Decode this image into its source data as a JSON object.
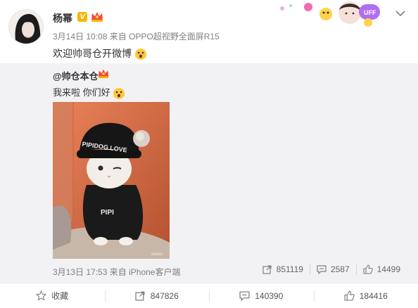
{
  "post": {
    "author": "杨幂",
    "verified_badge": "V",
    "time": "3月14日 10:08",
    "source_prefix": "来自",
    "source": "OPPO超视野全面屏R15",
    "text": "欢迎帅哥仓开微博"
  },
  "repost": {
    "author": "@帅仓本仓",
    "text": "我来啦 你们好",
    "photo_caption": "PIPIDOG LOVE",
    "shirt_text": "PIPI",
    "time": "3月13日 17:53",
    "source_prefix": "来自",
    "source": "iPhone客户端",
    "stats": {
      "reposts": "851119",
      "comments": "2587",
      "likes": "14499"
    }
  },
  "footer": {
    "favorite_label": "收藏",
    "repost_count": "847826",
    "comment_count": "140390",
    "like_count": "184416"
  },
  "colors": {
    "accent_gold": "#f7b500",
    "repost_bg": "#f2f2f5",
    "muted_text": "#808080"
  }
}
